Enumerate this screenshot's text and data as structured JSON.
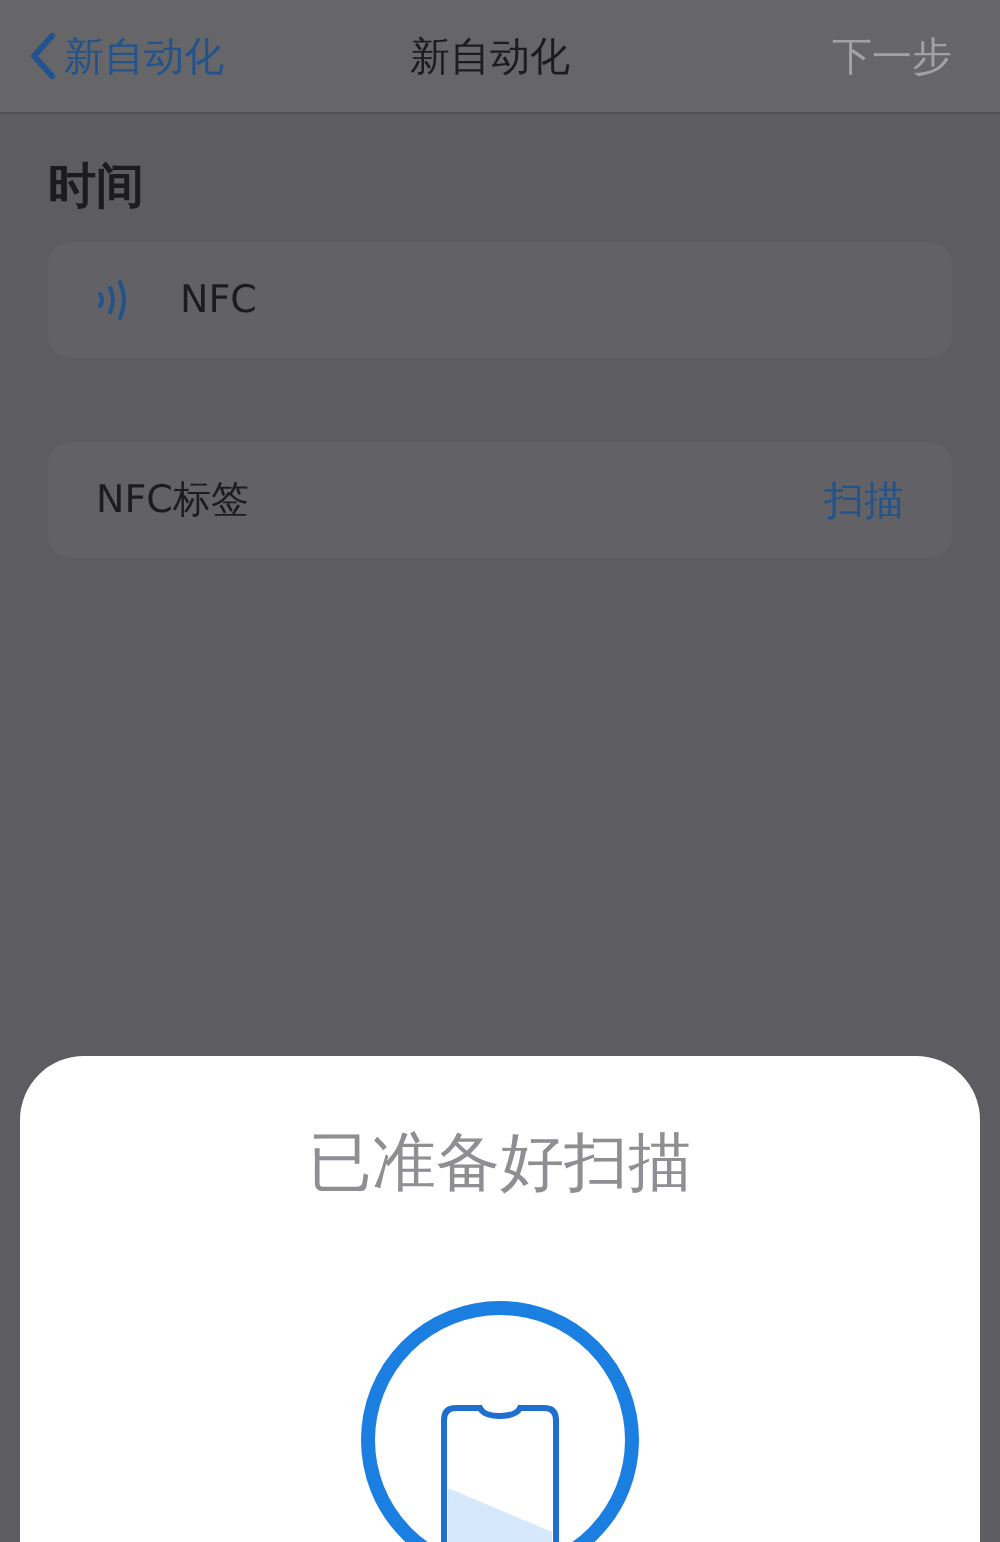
{
  "nav": {
    "back_label": "新自动化",
    "title": "新自动化",
    "next": {
      "label": "下一步",
      "disabled": true
    }
  },
  "section_header": "时间",
  "trigger": {
    "label": "NFC"
  },
  "tag_row": {
    "label": "NFC标签",
    "action": "扫描"
  },
  "sheet": {
    "title": "已准备好扫描"
  }
}
